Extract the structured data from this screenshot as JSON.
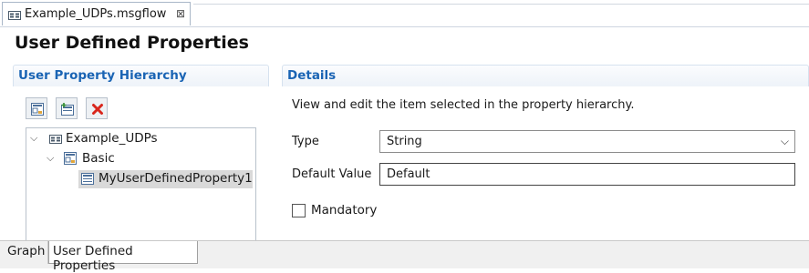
{
  "editor": {
    "tab_title": "Example_UDPs.msgflow",
    "close_glyph": "⊠"
  },
  "page_title": "User Defined Properties",
  "hierarchy": {
    "header": "User Property Hierarchy",
    "toolbar": {
      "add_group_icon": "add-group-icon",
      "add_property_icon": "add-property-icon",
      "delete_icon": "delete-icon"
    },
    "tree": [
      {
        "label": "Example_UDPs",
        "icon": "flow-icon",
        "expanded": true
      },
      {
        "label": "Basic",
        "icon": "group-icon",
        "expanded": true
      },
      {
        "label": "MyUserDefinedProperty1",
        "icon": "property-icon",
        "selected": true
      }
    ]
  },
  "details": {
    "header": "Details",
    "description": "View and edit the item selected in the property hierarchy.",
    "type_label": "Type",
    "type_value": "String",
    "default_label": "Default Value",
    "default_value": "Default",
    "mandatory_label": "Mandatory",
    "mandatory_checked": false
  },
  "bottom_tabs": [
    "Graph",
    "User Defined Properties"
  ],
  "active_bottom_tab": "User Defined Properties",
  "colors": {
    "section_header_text": "#1a64b4",
    "delete_red": "#d9261c",
    "selection": "#d9d9d9"
  }
}
